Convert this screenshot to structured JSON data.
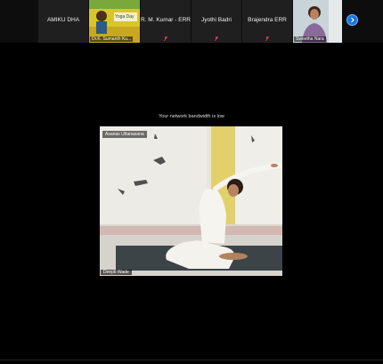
{
  "participants": [
    {
      "name": "AMIKU DHA",
      "muted": false
    },
    {
      "name": "Dr.K. Sumanth Ku...",
      "muted": false,
      "video": true
    },
    {
      "name": "R. M. Kumar - ERR",
      "muted": true
    },
    {
      "name": "Jyothi Badri",
      "muted": true
    },
    {
      "name": "Brajendra ERR",
      "muted": true
    },
    {
      "name": "Sweetha Nara",
      "muted": false,
      "video": true
    }
  ],
  "banner_text": "Yoga Day",
  "notice_text": "Your network bandwidth is low",
  "main_video": {
    "overlay_label": "Asanas Uttanasana",
    "speaker_name": "Deepti Wade"
  },
  "colors": {
    "accent": "#1473e6",
    "mute": "#e0413a",
    "background": "#000000"
  }
}
